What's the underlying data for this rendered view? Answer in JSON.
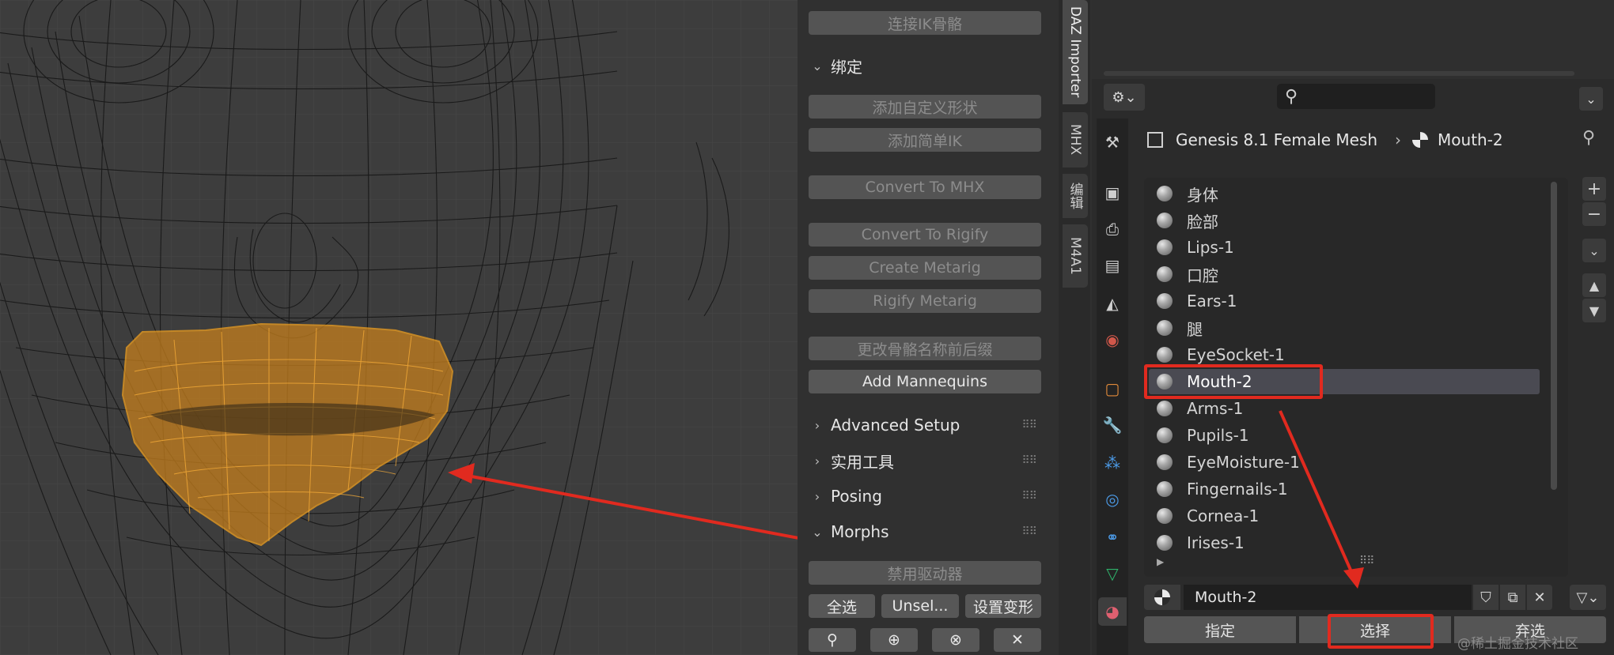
{
  "npanel": {
    "buttons": {
      "connect_ik": "连接IK骨骼",
      "add_custom_shape": "添加自定义形状",
      "add_simple_ik": "添加简单IK",
      "convert_mhx": "Convert To MHX",
      "convert_rigify": "Convert To Rigify",
      "create_metarig": "Create Metarig",
      "rigify_metarig": "Rigify Metarig",
      "rename_bone_affix": "更改骨骼名称前后缀",
      "add_mannequins": "Add Mannequins",
      "disable_drivers": "禁用驱动器",
      "select_all": "全选",
      "unselect": "Unsel...",
      "set_morph": "设置变形"
    },
    "sections": {
      "binding": "绑定",
      "advanced_setup": "Advanced Setup",
      "utilities": "实用工具",
      "posing": "Posing",
      "morphs": "Morphs"
    },
    "bottom_icons": [
      "bone-key-icon",
      "add-key-icon",
      "remove-key-icon",
      "close-icon"
    ]
  },
  "vertical_tabs": [
    "DAZ Importer",
    "MHX",
    "编辑",
    "M4A1"
  ],
  "props": {
    "search_placeholder": "",
    "breadcrumb": {
      "object": "Genesis 8.1 Female Mesh",
      "separator": "›",
      "material": "Mouth-2"
    },
    "materials": [
      "身体",
      "脸部",
      "Lips-1",
      "口腔",
      "Ears-1",
      "腿",
      "EyeSocket-1",
      "Mouth-2",
      "Arms-1",
      "Pupils-1",
      "EyeMoisture-1",
      "Fingernails-1",
      "Cornea-1",
      "Irises-1"
    ],
    "selected_material": "Mouth-2",
    "material_name_field": "Mouth-2",
    "buttons": {
      "assign": "指定",
      "select": "选择",
      "deselect": "弃选"
    }
  },
  "watermark": "@稀土掘金技术社区",
  "colors": {
    "highlight_red": "#e12a1f",
    "selection_orange": "#f0a020",
    "selected_row": "#4a4a52"
  }
}
